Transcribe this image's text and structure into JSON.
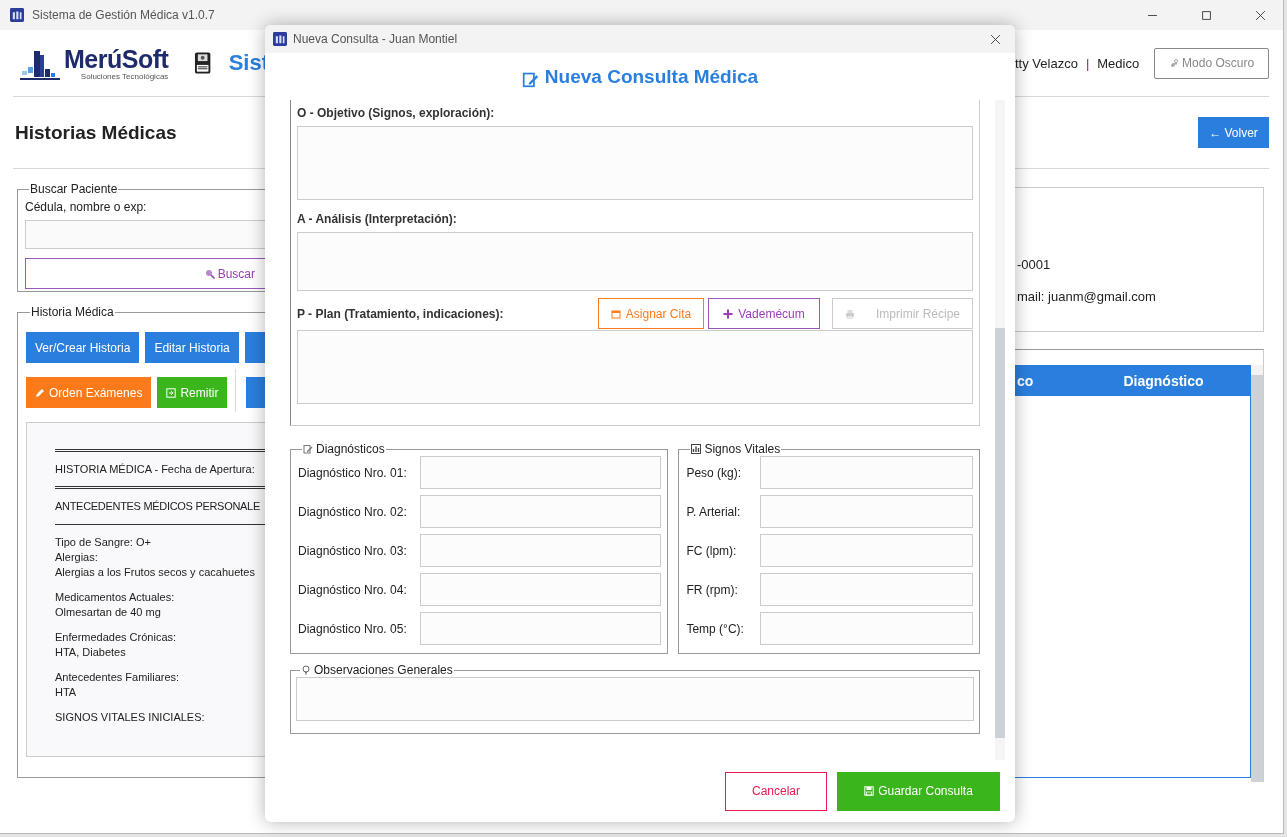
{
  "window": {
    "title": "Sistema de Gestión Médica v1.0.7"
  },
  "header": {
    "logo": "MerúSoft",
    "tagline": "Soluciones Tecnológicas",
    "app_title": "Sist",
    "user": "tty Velazco",
    "separator": "|",
    "role": "Medico",
    "theme_button": "Modo Oscuro"
  },
  "page": {
    "title": "Historias Médicas",
    "back_button": "← Volver"
  },
  "search": {
    "legend": "Buscar Paciente",
    "label": "Cédula, nombre o exp:",
    "button": "Buscar"
  },
  "history": {
    "legend": "Historia Médica",
    "button_rows": [
      [
        {
          "label": "Ver/Crear Historia",
          "kind": "primary"
        },
        {
          "label": "Editar Historia",
          "kind": "primary"
        },
        {
          "kind": "primary"
        }
      ],
      [
        {
          "label": "Orden Exámenes",
          "kind": "warning"
        },
        {
          "label": "Remitir",
          "kind": "success"
        },
        {
          "kind": "separator"
        },
        {
          "kind": "primary"
        }
      ]
    ],
    "record": [
      {
        "kind": "double-rule"
      },
      {
        "kind": "text",
        "lines": [
          "HISTORIA MÉDICA - Fecha de Apertura:"
        ]
      },
      {
        "kind": "double-rule"
      },
      {
        "kind": "text",
        "lines": [
          "ANTECEDENTES MÉDICOS PERSONALE"
        ]
      },
      {
        "kind": "rule"
      },
      {
        "kind": "text",
        "lines": [
          "Tipo de Sangre: O+",
          "Alergias:",
          "Alergias a los Frutos secos y cacahuetes"
        ]
      },
      {
        "kind": "text",
        "lines": [
          "Medicamentos Actuales:",
          "Olmesartan de 40 mg"
        ]
      },
      {
        "kind": "text",
        "lines": [
          "Enfermedades Crónicas:",
          "HTA, Diabetes"
        ]
      },
      {
        "kind": "text",
        "lines": [
          "Antecedentes Familiares:",
          "HTA"
        ]
      },
      {
        "kind": "text",
        "lines": [
          "SIGNOS VITALES INICIALES:"
        ]
      }
    ]
  },
  "patient": {
    "lines": [
      "-0001",
      "mail: juanm@gmail.com"
    ]
  },
  "table": {
    "columns": [
      "co",
      "Diagnóstico"
    ]
  },
  "dialog": {
    "title": "Nueva Consulta - Juan Montiel",
    "heading": "Nueva Consulta Médica",
    "soap": [
      {
        "label": "O - Objetivo (Signos, exploración):"
      },
      {
        "label": "A - Análisis (Interpretación):"
      },
      {
        "label": "P - Plan (Tratamiento, indicaciones):",
        "actions": [
          {
            "label": "Asignar Cita",
            "kind": "appointment",
            "disabled": false
          },
          {
            "label": "Vademécum",
            "kind": "vademecum",
            "disabled": false
          },
          {
            "label": "Imprimir Récipe",
            "kind": "print",
            "disabled": true
          }
        ]
      }
    ],
    "diagnoses": {
      "legend": "Diagnósticos",
      "rows": [
        "Diagnóstico Nro. 01:",
        "Diagnóstico Nro. 02:",
        "Diagnóstico Nro. 03:",
        "Diagnóstico Nro. 04:",
        "Diagnóstico Nro. 05:"
      ]
    },
    "vitals": {
      "legend": "Signos Vitales",
      "rows": [
        "Peso (kg):",
        "P. Arterial:",
        "FC (lpm):",
        "FR (rpm):",
        "Temp (°C):"
      ]
    },
    "observations": {
      "legend": "Observaciones Generales"
    },
    "buttons": [
      {
        "label": "Cancelar",
        "kind": "cancel"
      },
      {
        "label": "Guardar Consulta",
        "kind": "save"
      }
    ]
  }
}
